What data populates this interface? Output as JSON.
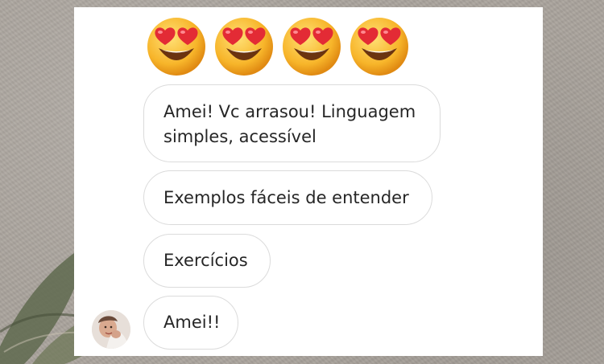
{
  "reactions": {
    "emoji_icon": "heart-eyes-emoji",
    "count": 4
  },
  "messages": [
    {
      "text": "Amei! Vc arrasou! Linguagem\nsimples, acessível"
    },
    {
      "text": "Exemplos fáceis de entender"
    },
    {
      "text": "Exercícios"
    },
    {
      "text": "Amei!!"
    }
  ],
  "sender": {
    "avatar_icon": "profile-photo-avatar"
  },
  "colors": {
    "bubble_border": "#dbdbdb",
    "text": "#262626",
    "card_background": "#ffffff",
    "backdrop": "#a9a39c",
    "emoji_face": "#f7b52a",
    "heart": "#e32b35"
  }
}
